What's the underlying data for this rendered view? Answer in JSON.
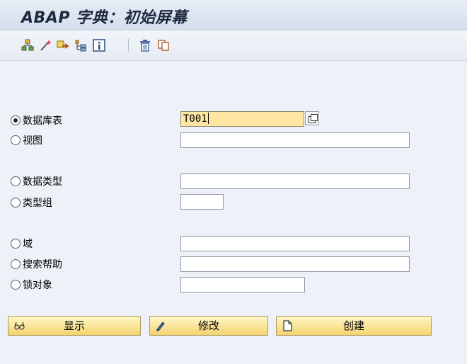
{
  "window": {
    "title": "ABAP 字典：初始屏幕"
  },
  "toolbar": {
    "icons": [
      "hierarchy-icon",
      "magic-wand-icon",
      "transport-icon",
      "where-used-icon",
      "info-icon",
      "delete-icon",
      "copy-icon"
    ]
  },
  "form": {
    "database_table": {
      "label": "数据库表",
      "value": "T001",
      "selected": true
    },
    "view": {
      "label": "视图",
      "value": ""
    },
    "data_type": {
      "label": "数据类型",
      "value": ""
    },
    "type_group": {
      "label": "类型组",
      "value": ""
    },
    "domain": {
      "label": "域",
      "value": ""
    },
    "search_help": {
      "label": "搜索帮助",
      "value": ""
    },
    "lock_object": {
      "label": "锁对象",
      "value": ""
    }
  },
  "buttons": {
    "display": "显示",
    "change": "修改",
    "create": "创建"
  },
  "colors": {
    "accent_field": "#ffe7a3",
    "button_yellow": "#f4d46f",
    "background": "#eef2f8"
  }
}
